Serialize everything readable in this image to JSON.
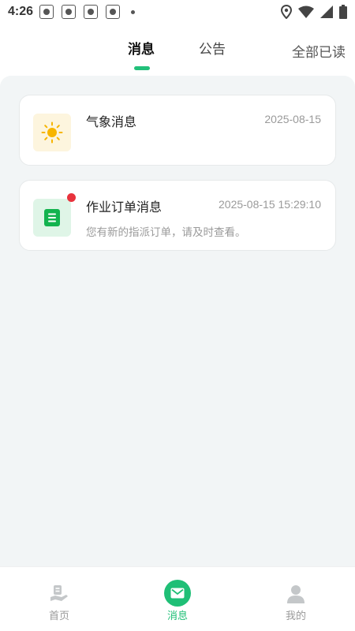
{
  "status_bar": {
    "time": "4:26",
    "notification_icons": [
      "paw-icon",
      "paw-icon",
      "paw-icon",
      "paw-icon"
    ],
    "right_icons": [
      "location-icon",
      "wifi-icon",
      "signal-icon",
      "battery-icon"
    ]
  },
  "header": {
    "tabs": [
      {
        "label": "消息",
        "active": true
      },
      {
        "label": "公告",
        "active": false
      }
    ],
    "mark_all_read": "全部已读"
  },
  "messages": [
    {
      "icon": "sun-icon",
      "title": "气象消息",
      "time": "2025-08-15",
      "description": "",
      "unread": false
    },
    {
      "icon": "document-icon",
      "title": "作业订单消息",
      "time": "2025-08-15 15:29:10",
      "description": "您有新的指派订单，请及时查看。",
      "unread": true
    }
  ],
  "bottom_nav": [
    {
      "label": "首页",
      "icon": "home-icon",
      "active": false
    },
    {
      "label": "消息",
      "icon": "mail-icon",
      "active": true
    },
    {
      "label": "我的",
      "icon": "user-icon",
      "active": false
    }
  ],
  "colors": {
    "accent": "#1fbf76",
    "unread_dot": "#e8323c",
    "background": "#f2f5f6"
  }
}
